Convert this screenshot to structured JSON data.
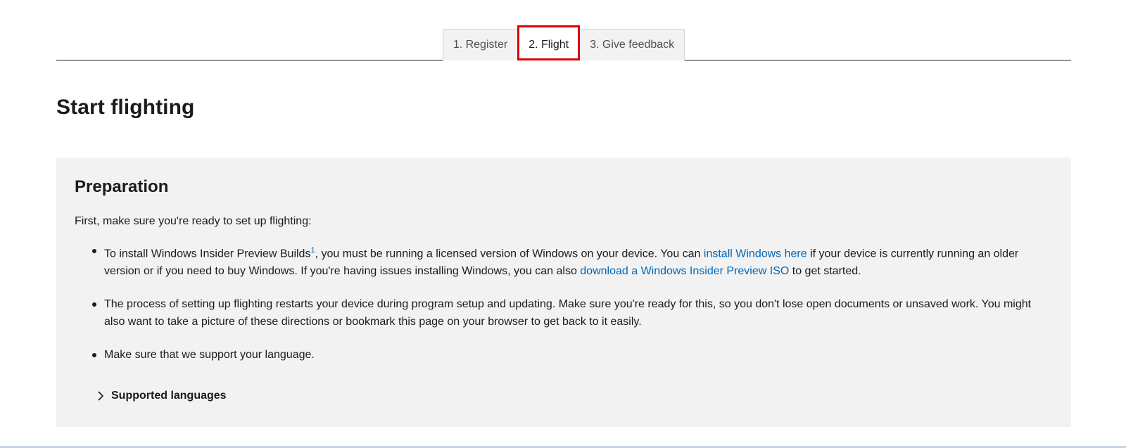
{
  "tabs": [
    {
      "label": "1. Register",
      "active": false
    },
    {
      "label": "2. Flight",
      "active": true
    },
    {
      "label": "3. Give feedback",
      "active": false
    }
  ],
  "page_title": "Start flighting",
  "preparation": {
    "heading": "Preparation",
    "intro": "First, make sure you're ready to set up flighting:",
    "bullet1": {
      "text_a": "To install Windows Insider Preview Builds",
      "footnote": "1",
      "text_b": ", you must be running a licensed version of Windows on your device. You can ",
      "link1": "install Windows here",
      "text_c": " if your device is currently running an older version or if you need to buy Windows. If you're having issues installing Windows, you can also ",
      "link2": "download a Windows Insider Preview ISO",
      "text_d": " to get started."
    },
    "bullet2": "The process of setting up flighting restarts your device during program setup and updating. Make sure you're ready for this, so you don't lose open documents or unsaved work. You might also want to take a picture of these directions or bookmark this page on your browser to get back to it easily.",
    "bullet3": "Make sure that we support your language.",
    "expander_label": "Supported languages"
  },
  "colors": {
    "link": "#0067b8",
    "panel_bg": "#f2f2f2",
    "active_tab_outline": "#e00000"
  },
  "icons": {
    "expander": "chevron-right-icon"
  }
}
